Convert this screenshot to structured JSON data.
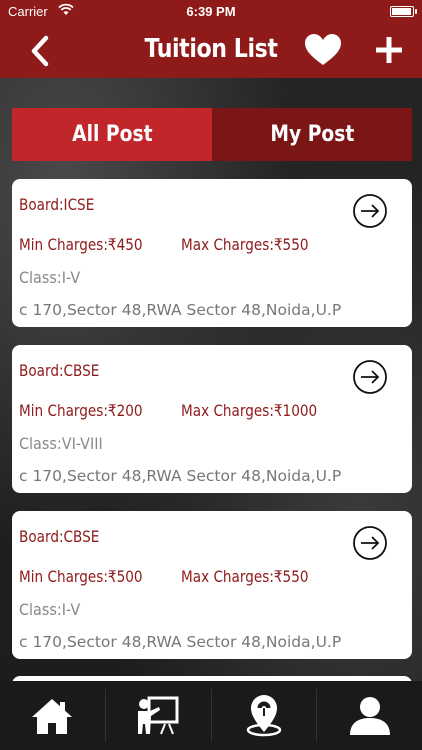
{
  "status_bar": {
    "carrier": "Carrier",
    "time": "6:39 PM",
    "battery_level": 1.0
  },
  "nav": {
    "title": "Tuition List",
    "back_icon": "chevron-left-icon",
    "favorite_icon": "heart-icon",
    "add_icon": "plus-icon"
  },
  "tabs": [
    {
      "label": "All Post",
      "active": true
    },
    {
      "label": "My Post",
      "active": false
    }
  ],
  "posts": [
    {
      "board": "Board:ICSE",
      "min_charges": "Min Charges:₹450",
      "max_charges": "Max Charges:₹550",
      "class": "Class:I-V",
      "address": "c 170,Sector 48,RWA Sector 48,Noida,U.P"
    },
    {
      "board": "Board:CBSE",
      "min_charges": "Min Charges:₹200",
      "max_charges": "Max Charges:₹1000",
      "class": "Class:VI-VIII",
      "address": "c 170,Sector 48,RWA Sector 48,Noida,U.P"
    },
    {
      "board": "Board:CBSE",
      "min_charges": "Min Charges:₹500",
      "max_charges": "Max Charges:₹550",
      "class": "Class:I-V",
      "address": "c 170,Sector 48,RWA Sector 48,Noida,U.P"
    }
  ],
  "bottom_tabs": [
    {
      "icon": "home-icon"
    },
    {
      "icon": "teacher-board-icon"
    },
    {
      "icon": "map-pin-icon"
    },
    {
      "icon": "user-profile-icon"
    }
  ],
  "colors": {
    "brand": "#8e1a1a",
    "tab_active": "#c0262a",
    "tab_inactive": "#7a1616"
  }
}
